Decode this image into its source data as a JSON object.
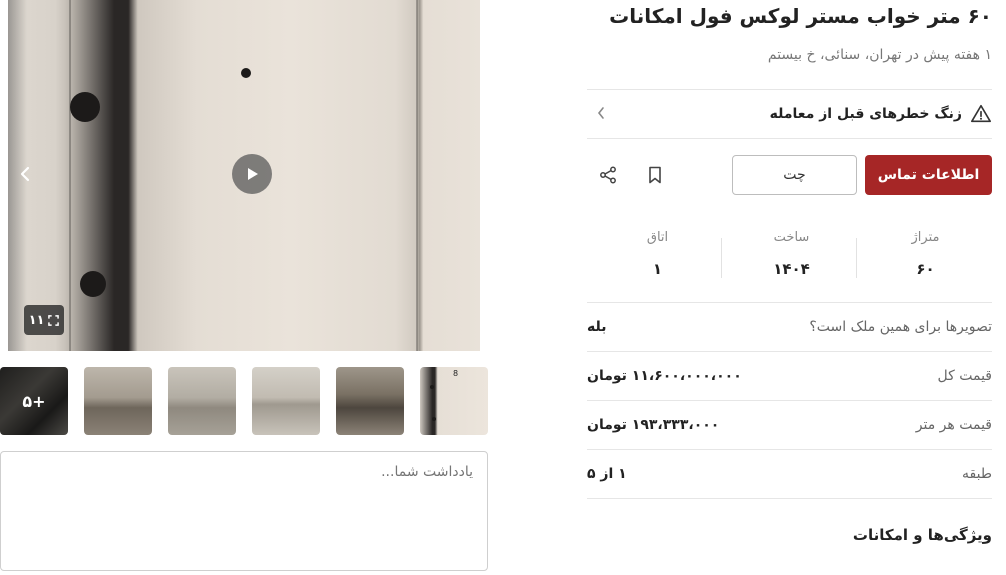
{
  "listing": {
    "title": "۶۰ متر خواب مستر لوکس فول امکانات",
    "subtitle": "۱ هفته پیش در تهران، سنائی، خ بیستم"
  },
  "gallery": {
    "photo_count": "۱۱",
    "more_thumbs": "۵+",
    "thumb_door_number": "8",
    "note_placeholder": "یادداشت شما..."
  },
  "risk": {
    "label": "زنگ خطرهای قبل از معامله"
  },
  "actions": {
    "contact_label": "اطلاعات تماس",
    "chat_label": "چت"
  },
  "stats": [
    {
      "label": "متراژ",
      "value": "۶۰"
    },
    {
      "label": "ساخت",
      "value": "۱۴۰۴"
    },
    {
      "label": "اتاق",
      "value": "۱"
    }
  ],
  "details": [
    {
      "key": "تصویرها برای همین ملک است؟",
      "value": "بله"
    },
    {
      "key": "قیمت کل",
      "value": "۱۱،۶۰۰،۰۰۰،۰۰۰ تومان"
    },
    {
      "key": "قیمت هر متر",
      "value": "۱۹۳،۳۳۳،۰۰۰ تومان"
    },
    {
      "key": "طبقه",
      "value": "۱ از ۵"
    }
  ],
  "features": {
    "heading": "ویژگی‌ها و امکانات"
  },
  "colors": {
    "primary": "#a62626",
    "divider": "#e6e6e6"
  },
  "icons": [
    "play-icon",
    "chevron-left-icon",
    "expand-icon",
    "warning-icon",
    "bookmark-icon",
    "share-icon"
  ]
}
